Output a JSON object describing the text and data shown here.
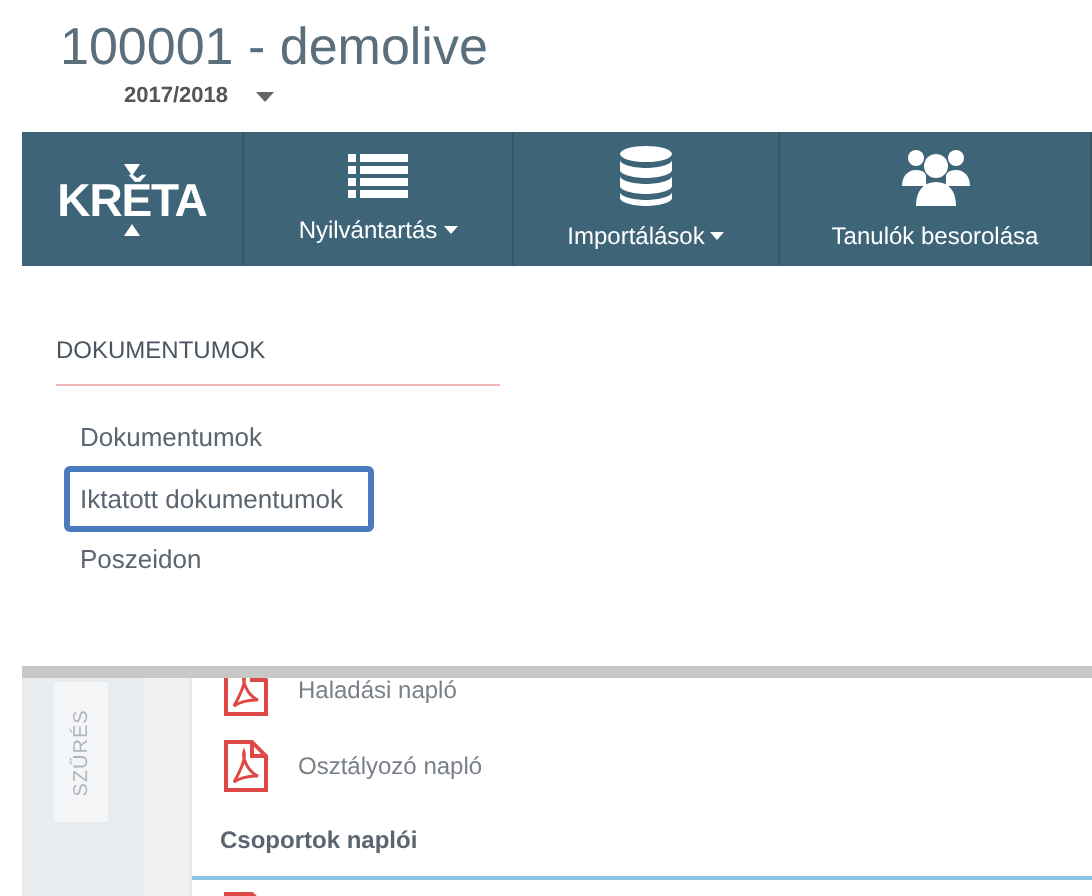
{
  "header": {
    "title": "100001 - demolive",
    "school_year": "2017/2018"
  },
  "navbar": {
    "logo": "KRĚTA",
    "items": [
      {
        "label": "Nyilvántartás",
        "dropdown": true
      },
      {
        "label": "Importálások",
        "dropdown": true
      },
      {
        "label": "Tanulók besorolása",
        "dropdown": false
      }
    ]
  },
  "menu": {
    "heading": "DOKUMENTUMOK",
    "items": [
      {
        "label": "Dokumentumok",
        "selected": false
      },
      {
        "label": "Iktatott dokumentumok",
        "selected": true
      },
      {
        "label": "Poszeidon",
        "selected": false
      }
    ]
  },
  "filter_tab": "SZŰRÉS",
  "documents": [
    {
      "kind": "file",
      "label": "Haladási napló"
    },
    {
      "kind": "file",
      "label": "Osztályozó napló"
    },
    {
      "kind": "group",
      "label": "Csoportok naplói"
    },
    {
      "kind": "file"
    }
  ]
}
